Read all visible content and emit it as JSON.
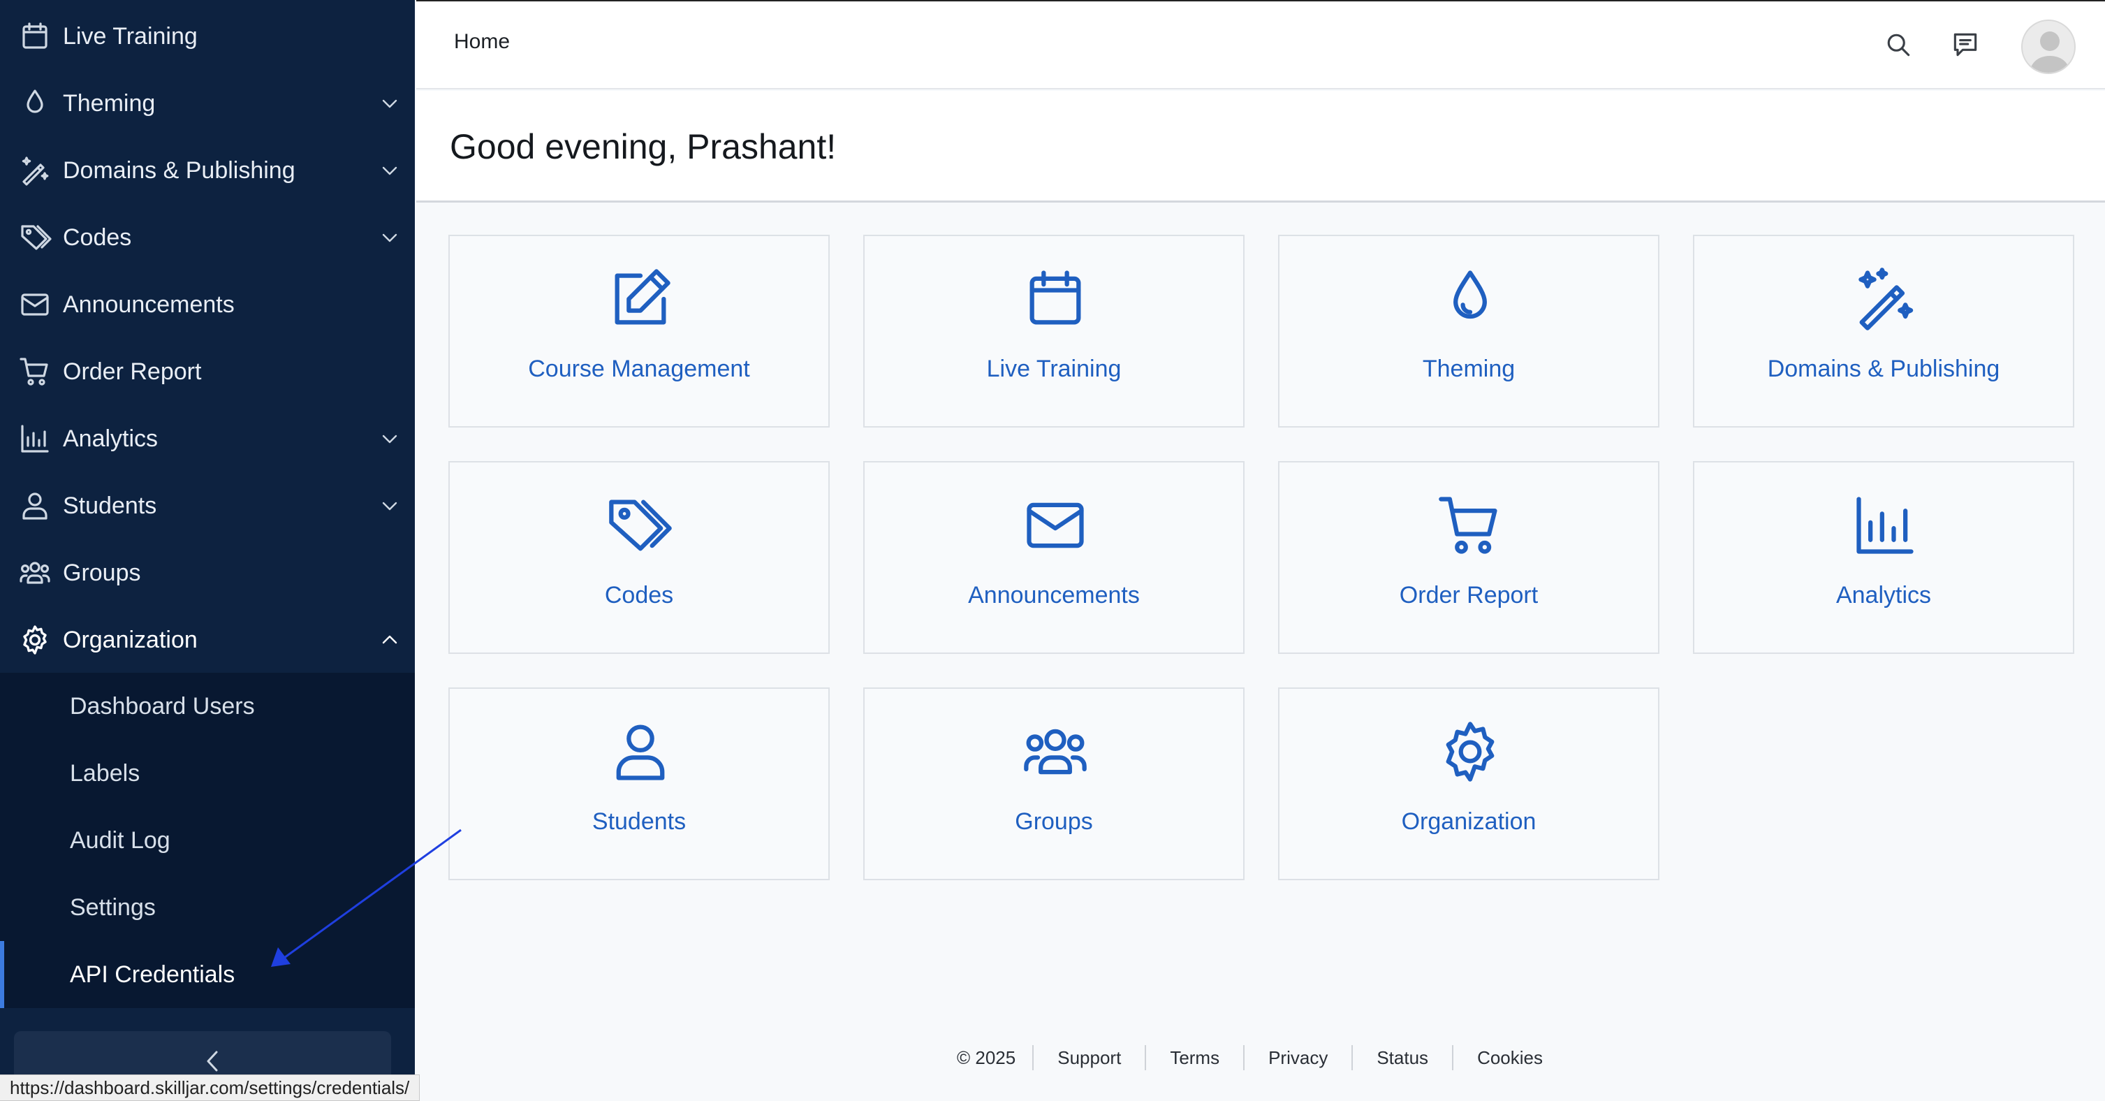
{
  "sidebar": {
    "items": [
      {
        "label": "Live Training"
      },
      {
        "label": "Theming"
      },
      {
        "label": "Domains & Publishing"
      },
      {
        "label": "Codes"
      },
      {
        "label": "Announcements"
      },
      {
        "label": "Order Report"
      },
      {
        "label": "Analytics"
      },
      {
        "label": "Students"
      },
      {
        "label": "Groups"
      },
      {
        "label": "Organization"
      }
    ],
    "organization_subitems": [
      {
        "label": "Dashboard Users"
      },
      {
        "label": "Labels"
      },
      {
        "label": "Audit Log"
      },
      {
        "label": "Settings"
      },
      {
        "label": "API Credentials"
      }
    ],
    "selected_subitem": "API Credentials"
  },
  "statusbar": {
    "url": "https://dashboard.skilljar.com/settings/credentials/"
  },
  "header": {
    "breadcrumb": "Home"
  },
  "main": {
    "greeting": "Good evening, Prashant!",
    "tiles": [
      {
        "label": "Course Management",
        "icon": "edit-icon"
      },
      {
        "label": "Live Training",
        "icon": "calendar-icon"
      },
      {
        "label": "Theming",
        "icon": "droplet-icon"
      },
      {
        "label": "Domains & Publishing",
        "icon": "magic-wand-icon"
      },
      {
        "label": "Codes",
        "icon": "tags-icon"
      },
      {
        "label": "Announcements",
        "icon": "envelope-icon"
      },
      {
        "label": "Order Report",
        "icon": "cart-icon"
      },
      {
        "label": "Analytics",
        "icon": "bar-chart-icon"
      },
      {
        "label": "Students",
        "icon": "user-icon"
      },
      {
        "label": "Groups",
        "icon": "users-icon"
      },
      {
        "label": "Organization",
        "icon": "gear-icon"
      }
    ]
  },
  "footer": {
    "copyright": "© 2025",
    "links": [
      {
        "label": "Support"
      },
      {
        "label": "Terms"
      },
      {
        "label": "Privacy"
      },
      {
        "label": "Status"
      },
      {
        "label": "Cookies"
      }
    ]
  },
  "colors": {
    "sidebar_bg": "#0d2240",
    "sidebar_sub_bg": "#081831",
    "accent": "#1f5fc0",
    "annotation_arrow": "#1f3fe0"
  }
}
